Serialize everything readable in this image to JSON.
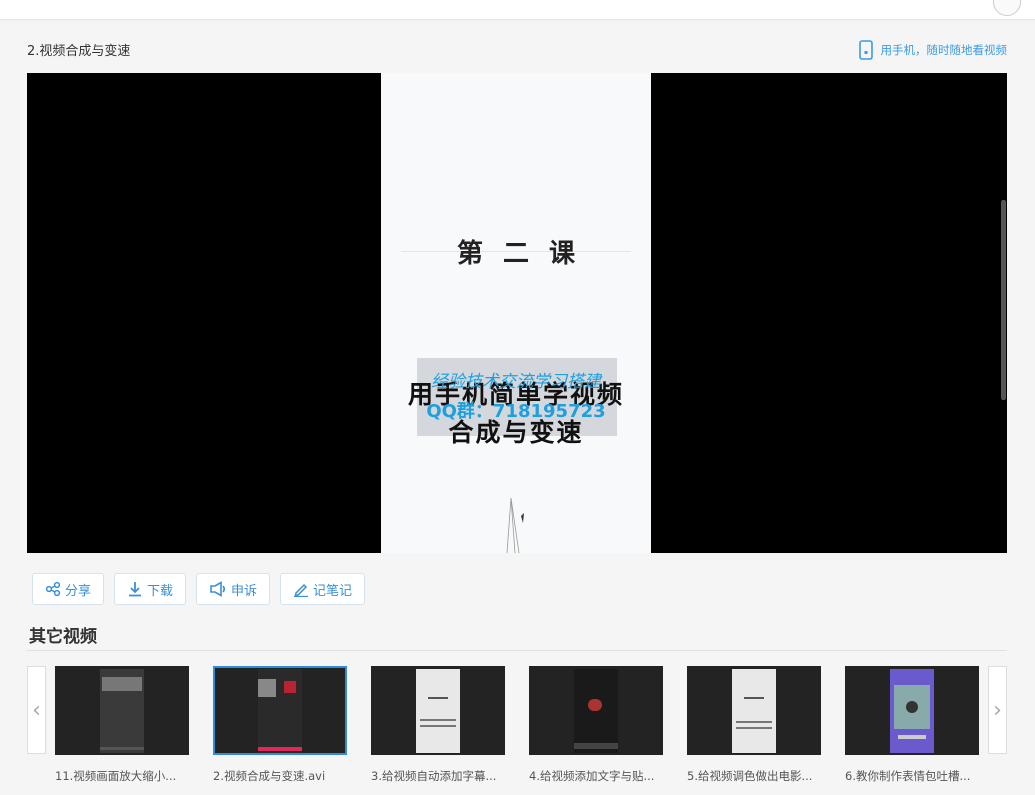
{
  "header": {
    "title": "2.视频合成与变速"
  },
  "mobile_link": {
    "label": "用手机，随时随地看视频"
  },
  "video_frame": {
    "lesson": "第二课",
    "title_line1": "用手机简单学视频",
    "title_line2": "合成与变速",
    "watermark_line1": "经验技术交流学习搭建",
    "watermark_line2": "QQ群：718195723"
  },
  "actions": [
    {
      "label": "分享",
      "icon": "share-icon"
    },
    {
      "label": "下载",
      "icon": "download-icon"
    },
    {
      "label": "申诉",
      "icon": "megaphone-icon"
    },
    {
      "label": "记笔记",
      "icon": "pencil-icon"
    }
  ],
  "others": {
    "title": "其它视频",
    "prev_arrow": "‹",
    "next_arrow": "›",
    "items": [
      {
        "caption": "11.视频画面放大缩小..."
      },
      {
        "caption": "2.视频合成与变速.avi",
        "active": true
      },
      {
        "caption": "3.给视频自动添加字幕..."
      },
      {
        "caption": "4.给视频添加文字与贴..."
      },
      {
        "caption": "5.给视频调色做出电影..."
      },
      {
        "caption": "6.教你制作表情包吐槽..."
      }
    ]
  },
  "colors": {
    "accent": "#3a8fd6",
    "watermark": "#1e9fe0",
    "active_border": "#2f8be0"
  }
}
